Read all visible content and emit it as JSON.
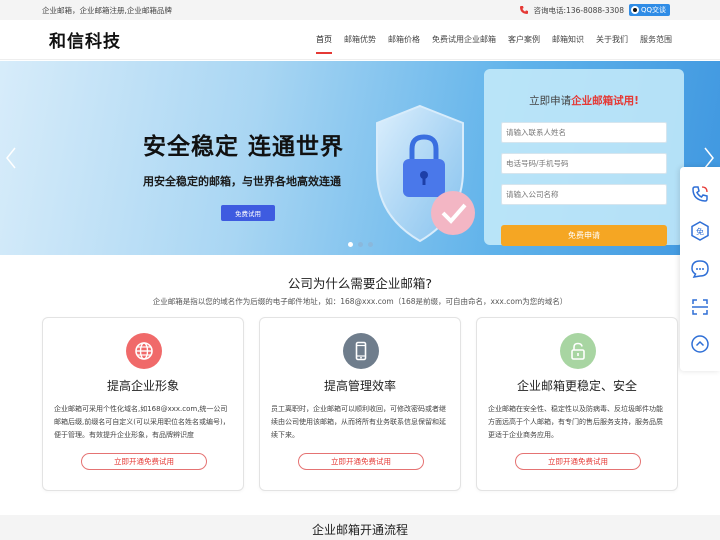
{
  "topbar": {
    "left_text": "企业邮箱，企业邮箱注册,企业邮箱品牌",
    "phone_label": "咨询电话:136-8088-3308",
    "qq_label": "QQ交谈"
  },
  "header": {
    "logo": "和信科技",
    "nav": [
      "首页",
      "邮箱优势",
      "邮箱价格",
      "免费试用企业邮箱",
      "客户案例",
      "邮箱知识",
      "关于我们",
      "服务范围"
    ]
  },
  "banner": {
    "title": "安全稳定  连通世界",
    "subtitle": "用安全稳定的邮箱，与世界各地高效连通",
    "cta_label": "免费试用",
    "slides": 3,
    "active_slide": 1
  },
  "form": {
    "title_prefix": "立即申请",
    "title_highlight": "企业邮箱试用!",
    "name_placeholder": "请输入联系人姓名",
    "phone_placeholder": "电话号码/手机号码",
    "company_placeholder": "请输入公司名称",
    "submit_label": "免费申请"
  },
  "sidebar": {
    "icons": [
      "phone-call-icon",
      "free-trial-icon",
      "chat-icon",
      "scan-qr-icon",
      "back-to-top-icon"
    ]
  },
  "why": {
    "title": "公司为什么需要企业邮箱?",
    "desc": "企业邮箱是指以您的域名作为后缀的电子邮件地址，如：168@xxx.com（168是前缀，可自由命名，xxx.com为您的域名）",
    "cards": [
      {
        "title": "提高企业形象",
        "desc": "企业邮箱可采用个性化域名,如168@xxx.com,统一公司邮箱后缀,前缀名可自定义(可以采用职位名姓名或编号)，便于管理。有效提升企业形象，有品牌辨识度",
        "button": "立即开通免费试用",
        "color": "#f06a6a",
        "icon": "globe-icon"
      },
      {
        "title": "提高管理效率",
        "desc": "员工离职时，企业邮箱可以顺利收回，可修改密码或者继续由公司使用该邮箱，从而将所有业务联系信息保留和延续下来。",
        "button": "立即开通免费试用",
        "color": "#6f7d8c",
        "icon": "mobile-icon"
      },
      {
        "title": "企业邮箱更稳定、安全",
        "desc": "企业邮箱在安全性、稳定性以及防病毒、反垃圾邮件功能方面远高于个人邮箱，有专门的售后服务支持，服务品质更适于企业商务应用。",
        "button": "立即开通免费试用",
        "color": "#a8d5a2",
        "icon": "unlock-icon"
      }
    ]
  },
  "process": {
    "title": "企业邮箱开通流程"
  },
  "colors": {
    "accent_red": "#e53935",
    "cta_blue": "#3e5be0",
    "submit_orange": "#f5a623"
  }
}
